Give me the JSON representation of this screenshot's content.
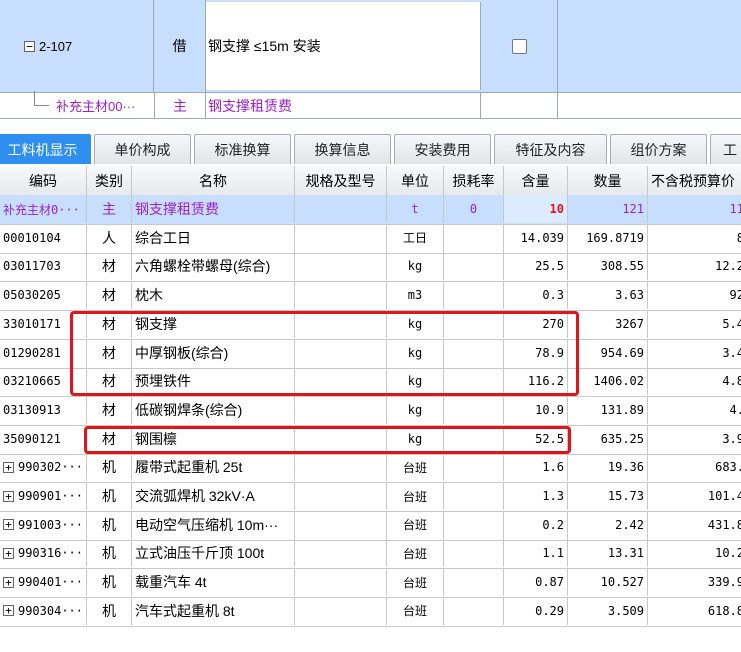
{
  "top_row": {
    "code": "2-107",
    "type": "借",
    "name": "钢支撑 ≤15m 安装"
  },
  "sub_row": {
    "code": "补充主材00···",
    "type": "主",
    "name": "钢支撑租赁费"
  },
  "tabs": [
    "工料机显示",
    "单价构成",
    "标准换算",
    "换算信息",
    "安装费用",
    "特征及内容",
    "组价方案",
    "工"
  ],
  "columns": [
    "编码",
    "类别",
    "名称",
    "规格及型号",
    "单位",
    "损耗率",
    "含量",
    "数量",
    "不含税预算价"
  ],
  "rows": [
    {
      "code": "补充主材0···",
      "type": "主",
      "name": "钢支撑租赁费",
      "spec": "",
      "unit": "t",
      "loss": "0",
      "qty": "10",
      "amount": "121",
      "price": "11"
    },
    {
      "code": "00010104",
      "type": "人",
      "name": "综合工日",
      "spec": "",
      "unit": "工日",
      "loss": "",
      "qty": "14.039",
      "amount": "169.8719",
      "price": "8"
    },
    {
      "code": "03011703",
      "type": "材",
      "name": "六角螺栓带螺母(综合)",
      "spec": "",
      "unit": "kg",
      "loss": "",
      "qty": "25.5",
      "amount": "308.55",
      "price": "12.2"
    },
    {
      "code": "05030205",
      "type": "材",
      "name": "枕木",
      "spec": "",
      "unit": "m3",
      "loss": "",
      "qty": "0.3",
      "amount": "3.63",
      "price": "92"
    },
    {
      "code": "33010171",
      "type": "材",
      "name": "钢支撑",
      "spec": "",
      "unit": "kg",
      "loss": "",
      "qty": "270",
      "amount": "3267",
      "price": "5.4"
    },
    {
      "code": "01290281",
      "type": "材",
      "name": "中厚钢板(综合)",
      "spec": "",
      "unit": "kg",
      "loss": "",
      "qty": "78.9",
      "amount": "954.69",
      "price": "3.4"
    },
    {
      "code": "03210665",
      "type": "材",
      "name": "预埋铁件",
      "spec": "",
      "unit": "kg",
      "loss": "",
      "qty": "116.2",
      "amount": "1406.02",
      "price": "4.8"
    },
    {
      "code": "03130913",
      "type": "材",
      "name": "低碳钢焊条(综合)",
      "spec": "",
      "unit": "kg",
      "loss": "",
      "qty": "10.9",
      "amount": "131.89",
      "price": "4."
    },
    {
      "code": "35090121",
      "type": "材",
      "name": "钢围檩",
      "spec": "",
      "unit": "kg",
      "loss": "",
      "qty": "52.5",
      "amount": "635.25",
      "price": "3.9"
    },
    {
      "code": "990302···",
      "type": "机",
      "name": "履带式起重机 25t",
      "spec": "",
      "unit": "台班",
      "loss": "",
      "qty": "1.6",
      "amount": "19.36",
      "price": "683."
    },
    {
      "code": "990901···",
      "type": "机",
      "name": "交流弧焊机 32kV·A",
      "spec": "",
      "unit": "台班",
      "loss": "",
      "qty": "1.3",
      "amount": "15.73",
      "price": "101.4"
    },
    {
      "code": "991003···",
      "type": "机",
      "name": "电动空气压缩机 10m···",
      "spec": "",
      "unit": "台班",
      "loss": "",
      "qty": "0.2",
      "amount": "2.42",
      "price": "431.8"
    },
    {
      "code": "990316···",
      "type": "机",
      "name": "立式油压千斤顶 100t",
      "spec": "",
      "unit": "台班",
      "loss": "",
      "qty": "1.1",
      "amount": "13.31",
      "price": "10.2"
    },
    {
      "code": "990401···",
      "type": "机",
      "name": "载重汽车 4t",
      "spec": "",
      "unit": "台班",
      "loss": "",
      "qty": "0.87",
      "amount": "10.527",
      "price": "339.9"
    },
    {
      "code": "990304···",
      "type": "机",
      "name": "汽车式起重机 8t",
      "spec": "",
      "unit": "台班",
      "loss": "",
      "qty": "0.29",
      "amount": "3.509",
      "price": "618.8"
    }
  ]
}
